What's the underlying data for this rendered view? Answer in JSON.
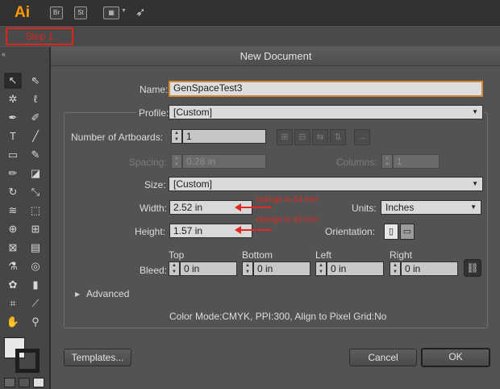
{
  "app": {
    "logo": "Ai",
    "bar_icons": [
      "Br",
      "St"
    ]
  },
  "step_label": "Step 1",
  "dialog": {
    "title": "New Document",
    "name_label": "Name:",
    "name_value": "GenSpaceTest3",
    "profile_label": "Profile:",
    "profile_value": "[Custom]",
    "artboards_label": "Number of Artboards:",
    "artboards_value": "1",
    "spacing_label": "Spacing:",
    "spacing_value": "0.28 in",
    "columns_label": "Columns:",
    "columns_value": "1",
    "size_label": "Size:",
    "size_value": "[Custom]",
    "width_label": "Width:",
    "width_value": "2.52 in",
    "height_label": "Height:",
    "height_value": "1.57 in",
    "units_label": "Units:",
    "units_value": "Inches",
    "orientation_label": "Orientation:",
    "bleed_label": "Bleed:",
    "bleed": {
      "top_label": "Top",
      "top_value": "0 in",
      "bottom_label": "Bottom",
      "bottom_value": "0 in",
      "left_label": "Left",
      "left_value": "0 in",
      "right_label": "Right",
      "right_value": "0 in"
    },
    "advanced_label": "Advanced",
    "summary": "Color Mode:CMYK, PPI:300, Align to Pixel Grid:No",
    "templates_button": "Templates...",
    "cancel_button": "Cancel",
    "ok_button": "OK"
  },
  "annotations": {
    "width_note": "change to 64 mm",
    "height_note": "change to 40 mm"
  },
  "colors": {
    "annotation_red": "#e02a1f",
    "logo_orange": "#ff9a00",
    "focus_orange": "#d08a3a"
  }
}
